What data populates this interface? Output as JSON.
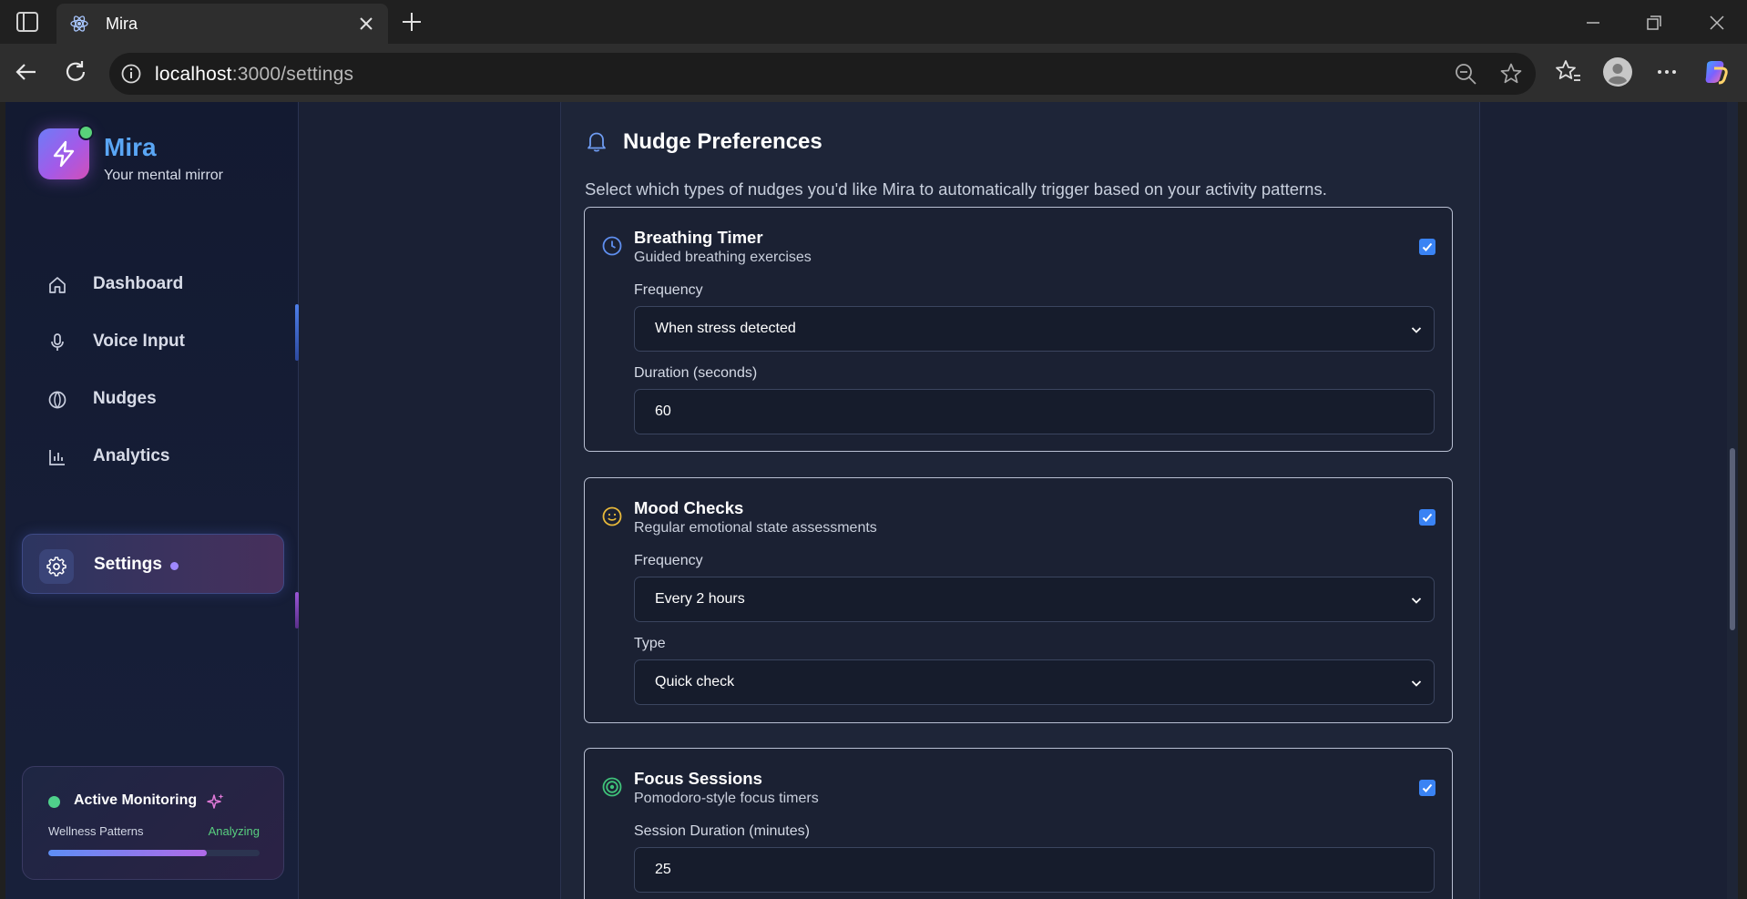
{
  "browser": {
    "tab_title": "Mira",
    "url_host": "localhost",
    "url_rest": ":3000/settings"
  },
  "sidebar": {
    "brand": "Mira",
    "tagline": "Your mental mirror",
    "items": [
      {
        "label": "Dashboard",
        "icon": "home-icon"
      },
      {
        "label": "Voice Input",
        "icon": "microphone-icon"
      },
      {
        "label": "Nudges",
        "icon": "leaf-icon"
      },
      {
        "label": "Analytics",
        "icon": "bar-chart-icon"
      },
      {
        "label": "Settings",
        "icon": "gear-icon",
        "active": true
      }
    ],
    "monitor": {
      "title": "Active Monitoring",
      "label": "Wellness Patterns",
      "status": "Analyzing",
      "progress": 0.75
    }
  },
  "panel": {
    "title": "Nudge Preferences",
    "description": "Select which types of nudges you'd like Mira to automatically trigger based on your activity patterns.",
    "cards": [
      {
        "title": "Breathing Timer",
        "subtitle": "Guided breathing exercises",
        "checked": true,
        "icon": "clock-icon",
        "fields": [
          {
            "label": "Frequency",
            "value": "When stress detected",
            "kind": "select"
          },
          {
            "label": "Duration (seconds)",
            "value": "60",
            "kind": "input"
          }
        ]
      },
      {
        "title": "Mood Checks",
        "subtitle": "Regular emotional state assessments",
        "checked": true,
        "icon": "smiley-icon",
        "fields": [
          {
            "label": "Frequency",
            "value": "Every 2 hours",
            "kind": "select"
          },
          {
            "label": "Type",
            "value": "Quick check",
            "kind": "select"
          }
        ]
      },
      {
        "title": "Focus Sessions",
        "subtitle": "Pomodoro-style focus timers",
        "checked": true,
        "icon": "target-icon",
        "fields": [
          {
            "label": "Session Duration (minutes)",
            "value": "25",
            "kind": "input"
          }
        ]
      }
    ]
  },
  "colors": {
    "accent_blue": "#3a83f4",
    "brand_blue": "#5aa6f5",
    "status_green": "#58cf7f"
  }
}
